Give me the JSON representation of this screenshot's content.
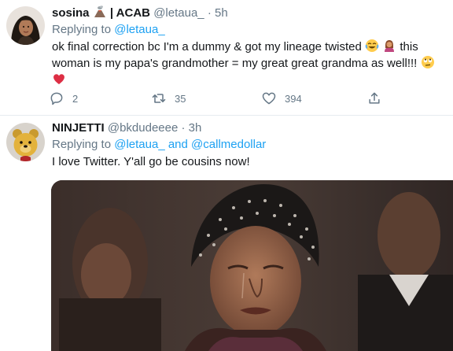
{
  "tweet1": {
    "display_name": "sosina",
    "name_suffix": "| ACAB",
    "name_emoji": "volcano-emoji",
    "handle": "@letaua_",
    "dot": "·",
    "time": "5h",
    "replying_prefix": "Replying to",
    "replying_to": "@letaua_",
    "text_line1": "ok final correction bc I'm a dummy & got my lineage twisted",
    "text_line1_end": "this",
    "text_line2": "woman is my papa's grandmother = my great great grandma as well!!!",
    "emojis": [
      "joy-emoji",
      "facepalm-woman-emoji",
      "rolling-eyes-emoji",
      "red-heart-emoji"
    ],
    "reply_count": "2",
    "retweet_count": "35",
    "like_count": "394"
  },
  "tweet2": {
    "display_name": "NINJETTI",
    "handle": "@bkdudeeee",
    "dot": "·",
    "time": "3h",
    "replying_prefix": "Replying to",
    "replying_to_1": "@letaua_",
    "replying_and": "and",
    "replying_to_2": "@callmedollar",
    "text": "I love Twitter. Y'all go be cousins now!",
    "media": "gif-crying-woman-beaded-headwrap"
  },
  "colors": {
    "link": "#1da1f2",
    "muted": "#657786",
    "text": "#14171a",
    "divider": "#e6ecf0",
    "heart": "#e0245e"
  }
}
